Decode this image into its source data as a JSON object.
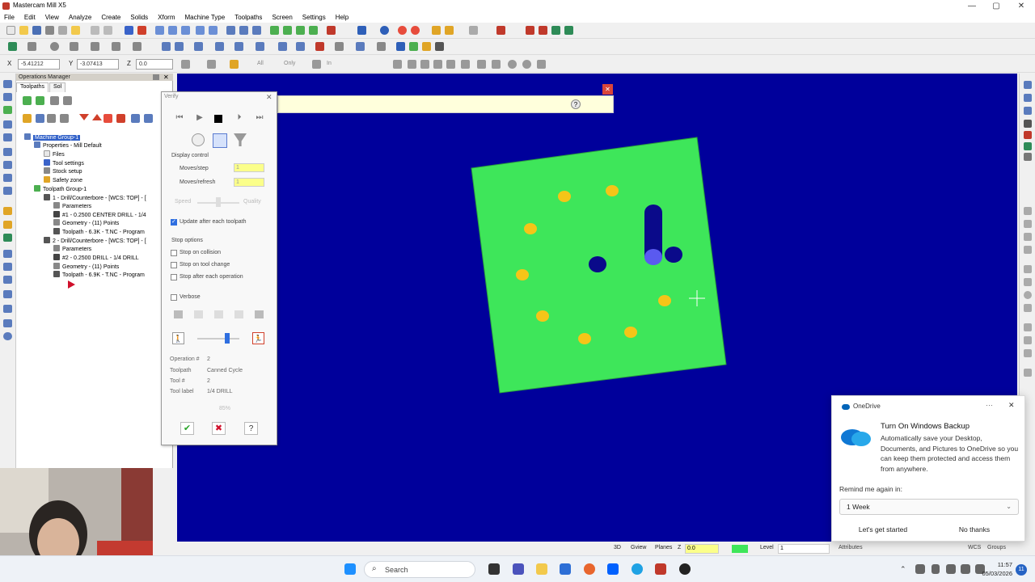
{
  "window": {
    "title": "Mastercam Mill X5",
    "min": "—",
    "max": "▢",
    "close": "✕"
  },
  "menu": [
    "File",
    "Edit",
    "View",
    "Analyze",
    "Create",
    "Solids",
    "Xform",
    "Machine Type",
    "Toolpaths",
    "Screen",
    "Settings",
    "Help"
  ],
  "coords": {
    "x_label": "X",
    "x_value": "-5.41212",
    "y_label": "Y",
    "y_value": "-3.07413",
    "z_label": "Z",
    "z_value": "0.0",
    "all_label": "All",
    "only_label": "Only",
    "in_label": "In"
  },
  "ops_manager": {
    "title": "Operations Manager",
    "tabs": [
      "Toolpaths",
      "Sol",
      "Verify"
    ],
    "tree": [
      {
        "text": "Machine Group-1",
        "selected": true
      },
      {
        "text": "Properties - Mill Default"
      },
      {
        "text": "Files"
      },
      {
        "text": "Tool settings"
      },
      {
        "text": "Stock setup"
      },
      {
        "text": "Safety zone"
      },
      {
        "text": "Toolpath Group-1"
      },
      {
        "text": "1 - Drill/Counterbore - [WCS: TOP] - ["
      },
      {
        "text": "Parameters"
      },
      {
        "text": "#1 - 0.2500 CENTER DRILL - 1/4"
      },
      {
        "text": "Geometry - (11) Points"
      },
      {
        "text": "Toolpath - 6.3K - T.NC - Program"
      },
      {
        "text": "2 - Drill/Counterbore - [WCS: TOP] - ["
      },
      {
        "text": "Parameters"
      },
      {
        "text": "#2 - 0.2500 DRILL - 1/4 DRILL"
      },
      {
        "text": "Geometry - (11) Points"
      },
      {
        "text": "Toolpath - 6.9K - T.NC - Program"
      }
    ]
  },
  "verify": {
    "title": "Verify",
    "display_control": "Display control",
    "moves_step_label": "Moves/step",
    "moves_step_value": "1",
    "moves_refresh_label": "Moves/refresh",
    "moves_refresh_value": "1",
    "speed_label": "Speed",
    "quality_label": "Quality",
    "update_after": "Update after each toolpath",
    "stop_options": "Stop options",
    "stop_collision": "Stop on collision",
    "stop_tool_change": "Stop on tool change",
    "stop_after_op": "Stop after each operation",
    "verbose": "Verbose",
    "operation_label": "Operation #",
    "operation_value": "2",
    "toolpath_label": "Toolpath",
    "toolpath_value": "Canned Cycle",
    "tool_label": "Tool #",
    "tool_value": "2",
    "toollabel_label": "Tool label",
    "toollabel_value": "1/4 DRILL",
    "progress": "85%",
    "speed_slider_level": 0.72
  },
  "status": {
    "d3": "3D",
    "gview": "Gview",
    "planes": "Planes",
    "z": "Z",
    "z_value": "0.0",
    "level_label": "Level",
    "level_value": "1",
    "attributes": "Attributes",
    "wcs": "WCS",
    "groups": "Groups"
  },
  "taskbar": {
    "search": "Search",
    "time": "11:57",
    "date": "05/03/2026",
    "badge": "11"
  },
  "toast": {
    "app": "OneDrive",
    "title": "Turn On Windows Backup",
    "body": "Automatically save your Desktop, Documents, and Pictures to OneDrive so you can keep them protected and access them from anywhere.",
    "remind_label": "Remind me again in:",
    "remind_value": "1 Week",
    "primary": "Let's get started",
    "secondary": "No thanks"
  },
  "colors": {
    "viewport": "#00009b",
    "stock": "#3ee65a",
    "yellow_holes": "#f5c518",
    "blue_holes": "#0a0a8a",
    "hint": "#ffffdc"
  }
}
